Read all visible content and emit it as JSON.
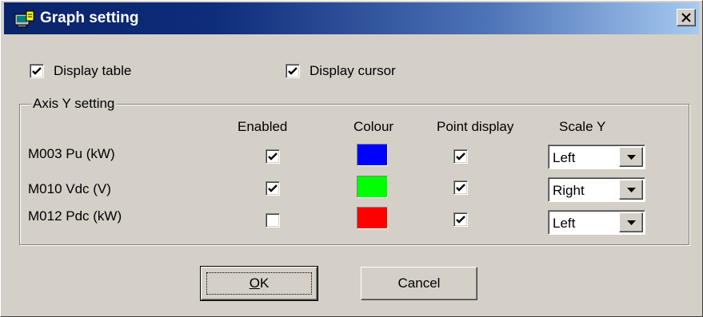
{
  "window": {
    "title": "Graph setting",
    "close_icon": "close-x-icon",
    "app_icon": "graph-window-icon"
  },
  "options": {
    "display_table": {
      "label": "Display table",
      "checked": true
    },
    "display_cursor": {
      "label": "Display cursor",
      "checked": true
    }
  },
  "axis_y_group": {
    "title": "Axis Y setting",
    "columns": {
      "enabled": "Enabled",
      "colour": "Colour",
      "point_display": "Point display",
      "scale_y": "Scale Y"
    },
    "rows": [
      {
        "label": "M003 Pu (kW)",
        "enabled": true,
        "colour": "#0000ff",
        "point_display": true,
        "scale_y": "Left"
      },
      {
        "label": "M010 Vdc (V)",
        "enabled": true,
        "colour": "#00ff00",
        "point_display": true,
        "scale_y": "Right"
      },
      {
        "label": "M012 Pdc (kW)",
        "enabled": false,
        "colour": "#ff0000",
        "point_display": true,
        "scale_y": "Left"
      }
    ]
  },
  "buttons": {
    "ok": {
      "label": "OK",
      "mnemonic": "O"
    },
    "cancel": {
      "label": "Cancel"
    }
  }
}
